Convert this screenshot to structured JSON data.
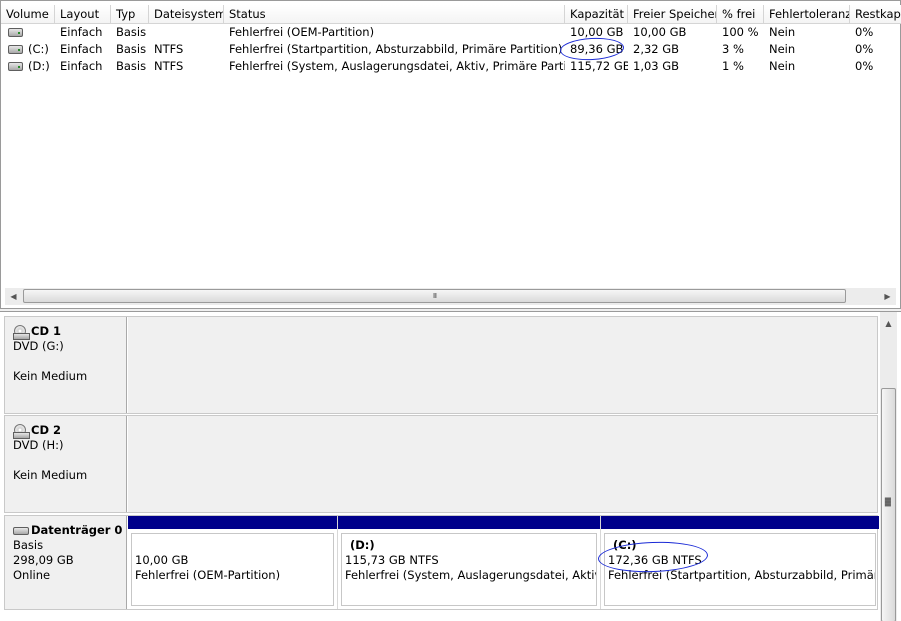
{
  "volume_list": {
    "columns": [
      "Volume",
      "Layout",
      "Typ",
      "Dateisystem",
      "Status",
      "Kapazität",
      "Freier Speicher",
      "% frei",
      "Fehlertoleranz",
      "Restkapa"
    ],
    "rows": [
      {
        "volume": "",
        "layout": "Einfach",
        "typ": "Basis",
        "dateisystem": "",
        "status": "Fehlerfrei (OEM-Partition)",
        "kapazitaet": "10,00 GB",
        "frei": "10,00 GB",
        "prozent": "100 %",
        "fehlertoleranz": "Nein",
        "rest": "0%"
      },
      {
        "volume": "(C:)",
        "layout": "Einfach",
        "typ": "Basis",
        "dateisystem": "NTFS",
        "status": "Fehlerfrei (Startpartition, Absturzabbild, Primäre Partition)",
        "kapazitaet": "89,36 GB",
        "frei": "2,32 GB",
        "prozent": "3 %",
        "fehlertoleranz": "Nein",
        "rest": "0%"
      },
      {
        "volume": "(D:)",
        "layout": "Einfach",
        "typ": "Basis",
        "dateisystem": "NTFS",
        "status": "Fehlerfrei (System, Auslagerungsdatei, Aktiv, Primäre Partition)",
        "kapazitaet": "115,72 GB",
        "frei": "1,03 GB",
        "prozent": "1 %",
        "fehlertoleranz": "Nein",
        "rest": "0%"
      }
    ],
    "scrollbar_grip": "III"
  },
  "disks": {
    "cd1": {
      "title": "CD 1",
      "drive": "DVD (G:)",
      "status": "Kein Medium"
    },
    "cd2": {
      "title": "CD 2",
      "drive": "DVD (H:)",
      "status": "Kein Medium"
    },
    "disk0": {
      "title": "Datenträger 0",
      "type": "Basis",
      "size": "298,09 GB",
      "status": "Online",
      "partitions": [
        {
          "name": "",
          "size": "10,00 GB",
          "status": "Fehlerfrei (OEM-Partition)"
        },
        {
          "name": "(D:)",
          "size": "115,73 GB NTFS",
          "status": "Fehlerfrei (System, Auslagerungsdatei, Aktiv, Pr"
        },
        {
          "name": "(C:)",
          "size": "172,36 GB NTFS",
          "status": "Fehlerfrei (Startpartition, Absturzabbild, Primäre P"
        }
      ]
    }
  },
  "colors": {
    "partition_bar": "#00008a",
    "annotation": "#1a2ad6"
  }
}
